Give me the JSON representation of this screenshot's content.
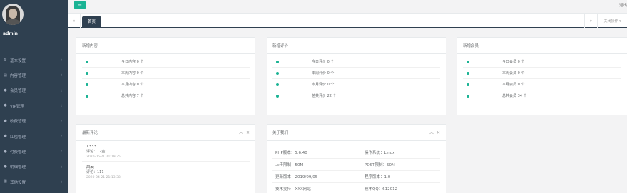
{
  "sidebar": {
    "user": "admin",
    "items": [
      {
        "label": "基本设置",
        "icon": "gear-icon"
      },
      {
        "label": "内容管理",
        "icon": "document-icon"
      },
      {
        "label": "会员管理",
        "icon": "user-icon"
      },
      {
        "label": "VIP管理",
        "icon": "user-icon"
      },
      {
        "label": "收费管理",
        "icon": "user-icon"
      },
      {
        "label": "红包管理",
        "icon": "user-icon"
      },
      {
        "label": "付费管理",
        "icon": "user-icon"
      },
      {
        "label": "明细管理",
        "icon": "user-icon"
      },
      {
        "label": "其他设置",
        "icon": "settings-icon"
      }
    ]
  },
  "topbar": {
    "right_text": "退出"
  },
  "tabs": {
    "home": "首页",
    "close_ops": "关闭操作"
  },
  "panels": {
    "content": {
      "title": "新增内容",
      "rows": [
        "今日内容 0 个",
        "本周内容 0 个",
        "本月内容 0 个",
        "总共内容 7 个"
      ]
    },
    "reviews": {
      "title": "新增评价",
      "rows": [
        "今日评价 0 个",
        "本周评价 0 个",
        "本月评价 0 个",
        "总共评价 22 个"
      ]
    },
    "members": {
      "title": "新增会员",
      "rows": [
        "今日会员 0 个",
        "本周会员 0 个",
        "本月会员 0 个",
        "总共会员 34 个"
      ]
    },
    "recent_comments": {
      "title": "最新评论",
      "items": [
        {
          "name": "1333",
          "line": "评论：12金",
          "date": "2020-06-21 21:19:35"
        },
        {
          "name": "风云",
          "line": "评论：111",
          "date": "2020-04-21 21:13:38"
        }
      ]
    },
    "system": {
      "title": "关于我们",
      "left": [
        "PHP版本：5.6.40",
        "上传限制：50M",
        "更新版本：2019/09/05",
        "技术支持：XXX网站"
      ],
      "right": [
        "操作系统：Linux",
        "POST限制：50M",
        "程序版本：1.0",
        "技术QQ：612012"
      ]
    }
  },
  "colors": {
    "sidebar_bg": "#2f4050",
    "accent": "#1ab394",
    "page_bg": "#f3f3f4"
  }
}
